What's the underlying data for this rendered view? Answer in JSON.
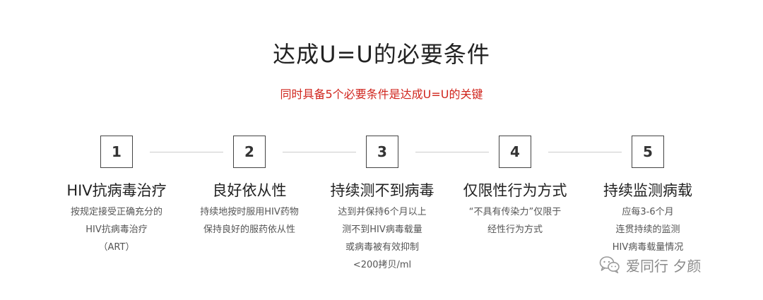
{
  "title": "达成U=U的必要条件",
  "subtitle": "同时具备5个必要条件是达成U=U的关键",
  "steps": [
    {
      "number": "1",
      "title": "HIV抗病毒治疗",
      "desc": [
        "按规定接受正确充分的",
        "HIV抗病毒治疗",
        "（ART）"
      ]
    },
    {
      "number": "2",
      "title": "良好依从性",
      "desc": [
        "持续地按时服用HIV药物",
        "保持良好的服药依从性"
      ]
    },
    {
      "number": "3",
      "title": "持续测不到病毒",
      "desc": [
        "达到并保持6个月以上",
        "测不到HIV病毒载量",
        "或病毒被有效抑制",
        "<200拷贝/ml"
      ]
    },
    {
      "number": "4",
      "title": "仅限性行为方式",
      "desc": [
        "“不具有传染力”仅限于",
        "经性行为方式"
      ]
    },
    {
      "number": "5",
      "title": "持续监测病载",
      "desc": [
        "应每3-6个月",
        "连贯持续的监测",
        "HIV病毒载量情况"
      ]
    }
  ],
  "watermark": {
    "icon": "wechat-icon",
    "text": "爱同行 夕颜"
  },
  "colors": {
    "accent": "#d0251d",
    "text": "#333333",
    "connector": "#cccccc"
  }
}
